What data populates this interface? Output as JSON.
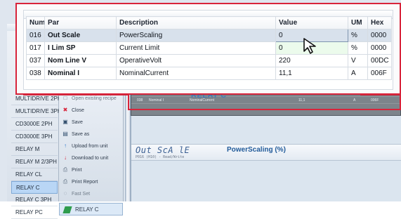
{
  "background": {
    "side_marks": [
      "Fa",
      "R",
      "C",
      "C",
      "M"
    ],
    "nav_items": [
      {
        "label": "MULTIDRIVE 2PH",
        "active": false
      },
      {
        "label": "MULTIDRIVE 3PH",
        "active": false
      },
      {
        "label": "CD3000E 2PH",
        "active": false
      },
      {
        "label": "CD3000E 3PH",
        "active": false
      },
      {
        "label": "RELAY M",
        "active": false
      },
      {
        "label": "RELAY M 2/3PH",
        "active": false
      },
      {
        "label": "RELAY CL",
        "active": false
      },
      {
        "label": "RELAY C",
        "active": true
      },
      {
        "label": "RELAY C 3PH",
        "active": false
      },
      {
        "label": "RELAY PC",
        "active": false
      }
    ],
    "menu_items": [
      {
        "label": "Open existing recipe",
        "icon": "folder-icon",
        "muted": true
      },
      {
        "label": "Close",
        "icon": "close-icon",
        "muted": false
      },
      {
        "label": "Save",
        "icon": "save-icon",
        "muted": false
      },
      {
        "label": "Save as",
        "icon": "save-as-icon",
        "muted": false
      },
      {
        "label": "Upload from unit",
        "icon": "upload-icon",
        "muted": false
      },
      {
        "label": "Download to unit",
        "icon": "download-icon",
        "muted": false
      },
      {
        "label": "Print",
        "icon": "print-icon",
        "muted": false
      },
      {
        "label": "Print Report",
        "icon": "print-report-icon",
        "muted": false
      },
      {
        "label": "Fast Set",
        "icon": "fast-set-icon",
        "muted": true
      }
    ],
    "device_label": "RELAY C",
    "watermark": "RELAY C",
    "mini_rows": [
      {
        "code": "037",
        "name": "Nom Line V",
        "desc": "OperativeVolt",
        "value": "220",
        "um": "V",
        "hex": "00DC"
      },
      {
        "code": "038",
        "name": "Nominal I",
        "desc": "NominalCurrent",
        "value": "11,1",
        "um": "A",
        "hex": "006F"
      }
    ],
    "detail": {
      "mnemonic": "Out ScA lE",
      "title": "PowerScaling (%)",
      "subtitle": "P016 (H10) - Read/Write"
    }
  },
  "zoom": {
    "headers": {
      "num": "Num",
      "par": "Par",
      "description": "Description",
      "value": "Value",
      "um": "UM",
      "hex": "Hex"
    },
    "rows": [
      {
        "num": "016",
        "par": "Out Scale",
        "description": "PowerScaling",
        "value": "0",
        "um": "%",
        "hex": "0000",
        "selected": true
      },
      {
        "num": "017",
        "par": "I Lim SP",
        "description": "Current Limit",
        "value": "0",
        "um": "%",
        "hex": "0000",
        "selected": false
      },
      {
        "num": "037",
        "par": "Nom Line V",
        "description": "OperativeVolt",
        "value": "220",
        "um": "V",
        "hex": "00DC",
        "selected": false
      },
      {
        "num": "038",
        "par": "Nominal I",
        "description": "NominalCurrent",
        "value": "11,1",
        "um": "A",
        "hex": "006F",
        "selected": false
      }
    ]
  },
  "colors": {
    "callout": "#d8243b",
    "selected_row": "#d8e1ec",
    "editable_value": "#ecfbec",
    "detail_title": "#225b9a"
  }
}
